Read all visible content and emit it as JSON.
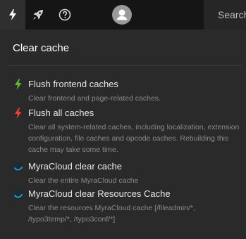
{
  "toolbar": {
    "icons": [
      "flash-icon",
      "rocket-icon",
      "help-icon",
      "avatar"
    ],
    "search_placeholder": "Search"
  },
  "panel": {
    "title": "Clear cache",
    "items": [
      {
        "icon": "lightning-green-icon",
        "title": "Flush frontend caches",
        "description": "Clear frontend and page-related caches."
      },
      {
        "icon": "lightning-red-icon",
        "title": "Flush all caches",
        "description": "Clear all system-related caches, including localization, extension configuration, file caches and opcode caches. Rebuilding this cache may take some time."
      },
      {
        "icon": "myracloud-icon",
        "title": "MyraCloud clear cache",
        "description": "Clear the entire MyraCloud cache"
      },
      {
        "icon": "myracloud-icon",
        "title": "MyraCloud clear Resources Cache",
        "description": "Clear the resources MyraCloud cache [/fileadmin/*, /typo3temp/*, /typo3conf/*]"
      }
    ]
  },
  "colors": {
    "toolbar_bg": "#151515",
    "panel_bg": "#2a2a2a",
    "green": "#5fb82f",
    "red": "#e8403a",
    "myra_blue": "#1aa7d8"
  }
}
